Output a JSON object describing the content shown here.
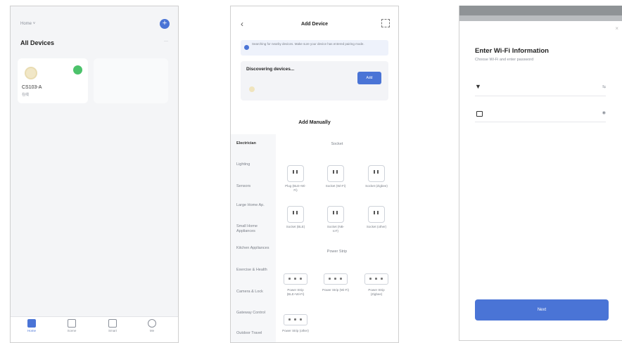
{
  "screen1": {
    "home_selector": "Home",
    "section_title": "All Devices",
    "more_label": "···",
    "device": {
      "name": "CS103-A",
      "status": "在线"
    },
    "tabs": [
      {
        "label": "Home"
      },
      {
        "label": "Scene"
      },
      {
        "label": "Smart"
      },
      {
        "label": "Me"
      }
    ]
  },
  "screen2": {
    "title": "Add Device",
    "hint": "Searching for nearby devices. Make sure your device has entered pairing mode.",
    "discovering": "Discovering devices...",
    "add_button": "Add",
    "manual_title": "Add Manually",
    "categories": [
      "Electrician",
      "Lighting",
      "Sensors",
      "Large Home Ap.",
      "Small Home Appliances",
      "Kitchen Appliances",
      "Exercise & Health",
      "Camera & Lock",
      "Gateway Control",
      "Outdoor Travel"
    ],
    "group1_title": "Socket",
    "group1_items": [
      "Plug (BLE+Wi-Fi)",
      "Socket (Wi-Fi)",
      "Socket (Zigbee)",
      "Socket (BLE)",
      "Socket (NB-IoT)",
      "Socket (other)"
    ],
    "group2_title": "Power Strip",
    "group2_items": [
      "Power Strip (BLE+Wi-Fi)",
      "Power Strip (Wi-Fi)",
      "Power Strip (Zigbee)",
      "Power Strip (other)"
    ]
  },
  "screen3": {
    "title": "Enter Wi-Fi Information",
    "subtitle": "Choose Wi-Fi and enter password",
    "wifi_value": "",
    "password_value": "",
    "next_button": "Next"
  },
  "colors": {
    "accent": "#4a74d6",
    "online": "#4cc26b"
  }
}
